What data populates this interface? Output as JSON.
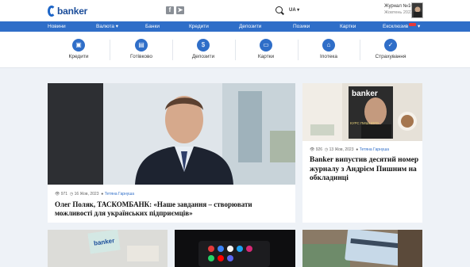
{
  "header": {
    "logo_text": "banker",
    "lang": "UA ▾",
    "magazine_title": "Журнал №10",
    "magazine_sub": "Жовтень 2023",
    "social_icons": [
      "facebook-icon",
      "telegram-icon"
    ]
  },
  "nav": {
    "items": [
      "Новини",
      "Валюта ▾",
      "Банки",
      "Кредити",
      "Депозити",
      "Позики",
      "Картки",
      "Ексклюзив"
    ],
    "live_dropdown": "▾"
  },
  "categories": [
    {
      "label": "Кредити",
      "icon": "briefcase-icon",
      "glyph": "▣"
    },
    {
      "label": "Готівково",
      "icon": "cash-icon",
      "glyph": "▤"
    },
    {
      "label": "Депозити",
      "icon": "moneybag-icon",
      "glyph": "$"
    },
    {
      "label": "Картки",
      "icon": "card-icon",
      "glyph": "▭"
    },
    {
      "label": "Іпотека",
      "icon": "house-icon",
      "glyph": "⌂"
    },
    {
      "label": "Страхування",
      "icon": "shield-icon",
      "glyph": "✓"
    }
  ],
  "articles": [
    {
      "views": "971",
      "date": "16 Жов, 2023",
      "author": "Тетяна Гарнуша",
      "title": "Олег Поляк, ТАСКОМБАНК: «Наше завдання – створювати можливості для українських підприємців»"
    },
    {
      "views": "926",
      "date": "13 Жов, 2023",
      "author": "Тетяна Гарнуша",
      "title": "Banker випустив десятий номер журналу з Андрієм Пишним на обкладинці",
      "cover_logo": "banker",
      "cover_text": "КУРС ПИШНОГО"
    }
  ],
  "bottom_card_logo": "banker"
}
